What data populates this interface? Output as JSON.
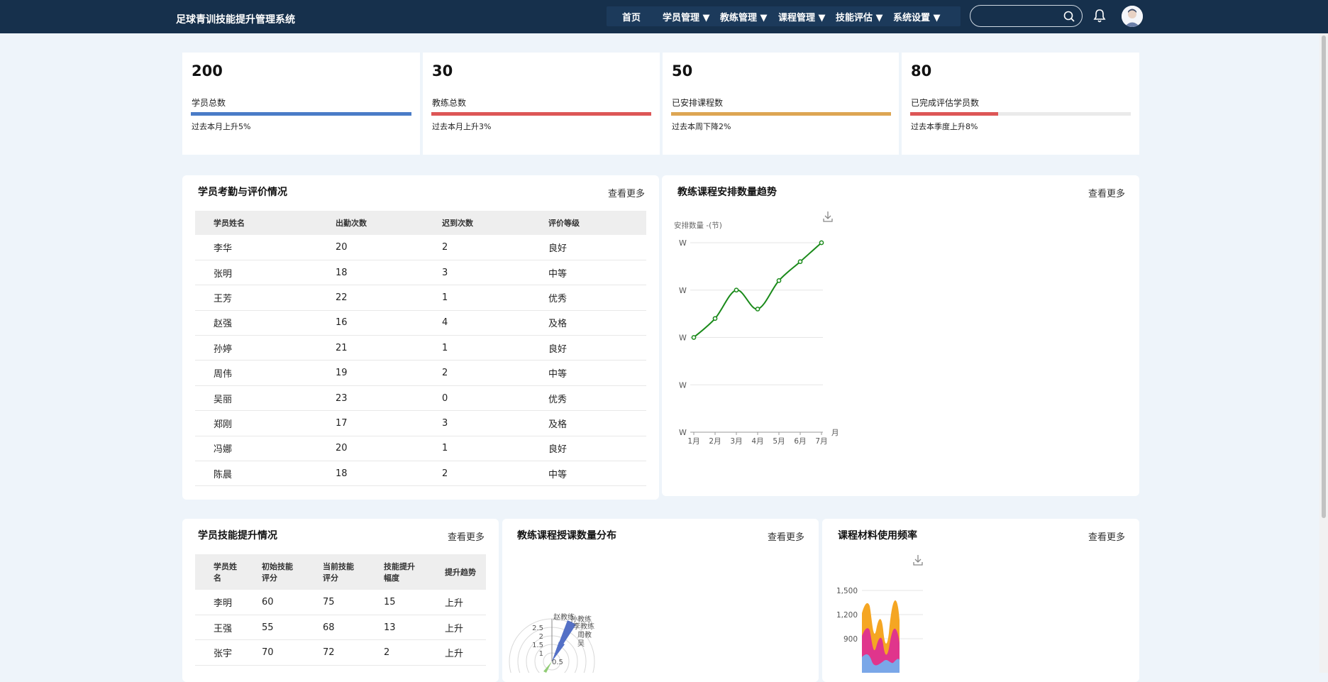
{
  "header": {
    "title": "足球青训技能提升管理系统",
    "nav": [
      "首页",
      "学员管理 ▼",
      "教练管理 ▼",
      "课程管理 ▼",
      "技能评估 ▼",
      "系统设置 ▼"
    ],
    "search_value": ""
  },
  "stats": [
    {
      "value": "200",
      "label": "学员总数",
      "change": "过去本月上升5%",
      "progress": 1.0,
      "color": "#4a7cc7"
    },
    {
      "value": "30",
      "label": "教练总数",
      "change": "过去本月上升3%",
      "progress": 1.0,
      "color": "#dd5656"
    },
    {
      "value": "50",
      "label": "已安排课程数",
      "change": "过去本周下降2%",
      "progress": 1.0,
      "color": "#dda653"
    },
    {
      "value": "80",
      "label": "已完成评估学员数",
      "change": "过去本季度上升8%",
      "progress": 0.4,
      "color": "#dd5656"
    }
  ],
  "attendance": {
    "title": "学员考勤与评价情况",
    "more": "查看更多",
    "columns": [
      "学员姓名",
      "出勤次数",
      "迟到次数",
      "评价等级"
    ],
    "rows": [
      [
        "李华",
        "20",
        "2",
        "良好"
      ],
      [
        "张明",
        "18",
        "3",
        "中等"
      ],
      [
        "王芳",
        "22",
        "1",
        "优秀"
      ],
      [
        "赵强",
        "16",
        "4",
        "及格"
      ],
      [
        "孙婷",
        "21",
        "1",
        "良好"
      ],
      [
        "周伟",
        "19",
        "2",
        "中等"
      ],
      [
        "吴丽",
        "23",
        "0",
        "优秀"
      ],
      [
        "郑刚",
        "17",
        "3",
        "及格"
      ],
      [
        "冯娜",
        "20",
        "1",
        "良好"
      ],
      [
        "陈晨",
        "18",
        "2",
        "中等"
      ]
    ]
  },
  "trend": {
    "title": "教练课程安排数量趋势",
    "more": "查看更多",
    "chart_data": {
      "type": "line",
      "ylabel": "安排数量 -(节)",
      "xlabel": "月",
      "categories": [
        "1月",
        "2月",
        "3月",
        "4月",
        "5月",
        "6月",
        "7月"
      ],
      "y_tick_labels": [
        "W",
        "W",
        "W",
        "W",
        "W"
      ],
      "ylim": [
        0,
        40
      ],
      "values": [
        20,
        24,
        30,
        26,
        32,
        36,
        40
      ],
      "smooth": true,
      "color": "#1a8a1a",
      "grid": true
    }
  },
  "skills": {
    "title": "学员技能提升情况",
    "more": "查看更多",
    "columns": [
      "学员姓名",
      "初始技能评分",
      "当前技能评分",
      "技能提升幅度",
      "提升趋势"
    ],
    "rows": [
      [
        "李明",
        "60",
        "75",
        "15",
        "上升"
      ],
      [
        "王强",
        "55",
        "68",
        "13",
        "上升"
      ],
      [
        "张宇",
        "70",
        "72",
        "2",
        "上升"
      ]
    ]
  },
  "distribution": {
    "title": "教练课程授课数量分布",
    "more": "查看更多",
    "chart_data": {
      "type": "polar-bar",
      "radial_ticks": [
        "2.5",
        "2",
        "1.5",
        "1",
        "0.5"
      ],
      "categories_visible": [
        "赵教练",
        "孙教练",
        "李教练",
        "周教",
        "吴"
      ]
    }
  },
  "materials": {
    "title": "课程材料使用频率",
    "more": "查看更多",
    "chart_data": {
      "type": "area",
      "y_tick_labels": [
        "1,500",
        "1,200",
        "900"
      ],
      "ylim": [
        900,
        1500
      ],
      "colors": [
        "#f5a623",
        "#e0358c",
        "#7aa7e8"
      ]
    }
  }
}
